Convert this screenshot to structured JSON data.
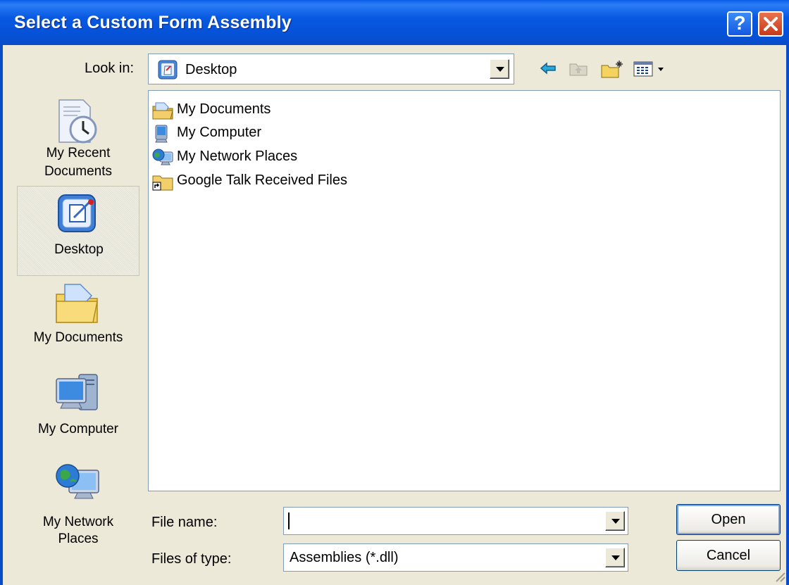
{
  "window": {
    "title": "Select a Custom Form Assembly",
    "help_glyph": "?",
    "close_icon": "close-icon"
  },
  "toolbar": {
    "lookin_label": "Look in:",
    "lookin_value": "Desktop",
    "tools": [
      "back-arrow-icon",
      "up-folder-icon",
      "new-folder-icon",
      "view-menu-icon"
    ]
  },
  "places": [
    {
      "label_line1": "My Recent",
      "label_line2": "Documents",
      "icon": "recent-documents-icon"
    },
    {
      "label_line1": "Desktop",
      "label_line2": "",
      "icon": "desktop-icon",
      "selected": true
    },
    {
      "label_line1": "My Documents",
      "label_line2": "",
      "icon": "my-documents-icon"
    },
    {
      "label_line1": "My Computer",
      "label_line2": "",
      "icon": "my-computer-icon"
    },
    {
      "label_line1": "My Network",
      "label_line2": "Places",
      "icon": "network-places-icon"
    }
  ],
  "files": [
    {
      "name": "My Documents",
      "icon": "my-documents-icon"
    },
    {
      "name": "My Computer",
      "icon": "my-computer-icon"
    },
    {
      "name": "My Network Places",
      "icon": "network-places-icon"
    },
    {
      "name": "Google Talk Received Files",
      "icon": "folder-shortcut-icon"
    }
  ],
  "form": {
    "file_name_label": "File name:",
    "file_name_value": "",
    "files_of_type_label": "Files of type:",
    "files_of_type_value": "Assemblies (*.dll)"
  },
  "buttons": {
    "open": "Open",
    "cancel": "Cancel"
  },
  "colors": {
    "titlebar": "#0758e2",
    "dialog_bg": "#ece9d8",
    "border": "#7f9db9"
  }
}
